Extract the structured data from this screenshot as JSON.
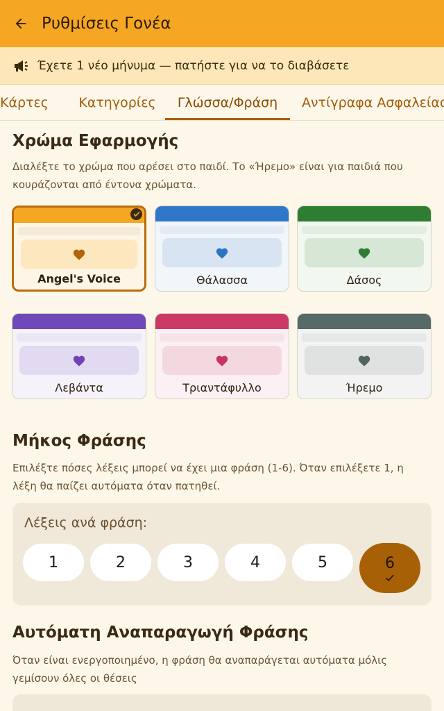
{
  "appbar": {
    "title": "Ρυθμίσεις Γονέα",
    "back_icon": "arrow-left-icon",
    "color": "#f5a623"
  },
  "banner": {
    "icon": "megaphone-icon",
    "text": "Έχετε 1 νέο μήνυμα — πατήστε για να το διαβάσετε"
  },
  "tabs": [
    {
      "label": "Κάρτες",
      "active": false
    },
    {
      "label": "Κατηγορίες",
      "active": false
    },
    {
      "label": "Γλώσσα/Φράση",
      "active": true
    },
    {
      "label": "Αντίγραφα Ασφαλείας",
      "active": false
    }
  ],
  "app_color": {
    "title": "Χρώμα Εφαρμογής",
    "description": "Διαλέξτε το χρώμα που αρέσει στο παιδί. Το «Ήρεμο» είναι για παιδιά που κουράζονται από έντονα χρώματα.",
    "themes": [
      {
        "label": "Angel's Voice",
        "selected": true,
        "bar": "#f5a623",
        "bg": "#fdf5e6",
        "line": "#f3ead8",
        "box": "#fde7bf",
        "heart": "#b0650a"
      },
      {
        "label": "Θάλασσα",
        "selected": false,
        "bar": "#2f78c9",
        "bg": "#f1f6fb",
        "line": "#e3ebf4",
        "box": "#d8e4f1",
        "heart": "#2b74c4"
      },
      {
        "label": "Δάσος",
        "selected": false,
        "bar": "#2f7d32",
        "bg": "#f2f7f0",
        "line": "#e3ede1",
        "box": "#d7e7d5",
        "heart": "#2f7d32"
      },
      {
        "label": "Λεβάντα",
        "selected": false,
        "bar": "#7049b8",
        "bg": "#f5f2fa",
        "line": "#ebe6f3",
        "box": "#e2daf0",
        "heart": "#6c45b3"
      },
      {
        "label": "Τριαντάφυλλο",
        "selected": false,
        "bar": "#cc3864",
        "bg": "#fbf1f4",
        "line": "#f5e3e8",
        "box": "#f3d8df",
        "heart": "#c93561"
      },
      {
        "label": "Ήρεμο",
        "selected": false,
        "bar": "#566a68",
        "bg": "#f2f3f2",
        "line": "#e6e8e7",
        "box": "#dfe2e1",
        "heart": "#526462"
      }
    ]
  },
  "phrase_length": {
    "title": "Μήκος Φράσης",
    "description": "Επιλέξτε πόσες λέξεις μπορεί να έχει μια φράση (1-6). Όταν επιλέξετε 1, η λέξη θα παίζει αυτόματα όταν πατηθεί.",
    "words_label": "Λέξεις ανά φράση:",
    "options": [
      "1",
      "2",
      "3",
      "4",
      "5",
      "6"
    ],
    "selected": "6"
  },
  "auto_play": {
    "title": "Αυτόματη Αναπαραγωγή Φράσης",
    "description": "Όταν είναι ενεργοποιημένο, η φράση θα αναπαράγεται αυτόματα μόλις γεμίσουν όλες οι θέσεις"
  }
}
